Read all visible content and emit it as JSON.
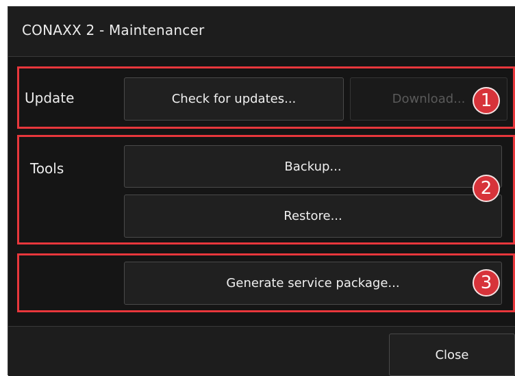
{
  "window": {
    "title": "CONAXX 2 - Maintenancer"
  },
  "sections": {
    "update": {
      "label": "Update",
      "check_button": "Check for updates...",
      "download_button": "Download...",
      "badge": "1"
    },
    "tools": {
      "label": "Tools",
      "backup_button": "Backup...",
      "restore_button": "Restore...",
      "badge": "2"
    },
    "service": {
      "generate_button": "Generate service package...",
      "badge": "3"
    }
  },
  "footer": {
    "close_button": "Close"
  },
  "colors": {
    "window_bg": "#151515",
    "highlight": "#e8373c",
    "badge": "#d7333a"
  }
}
